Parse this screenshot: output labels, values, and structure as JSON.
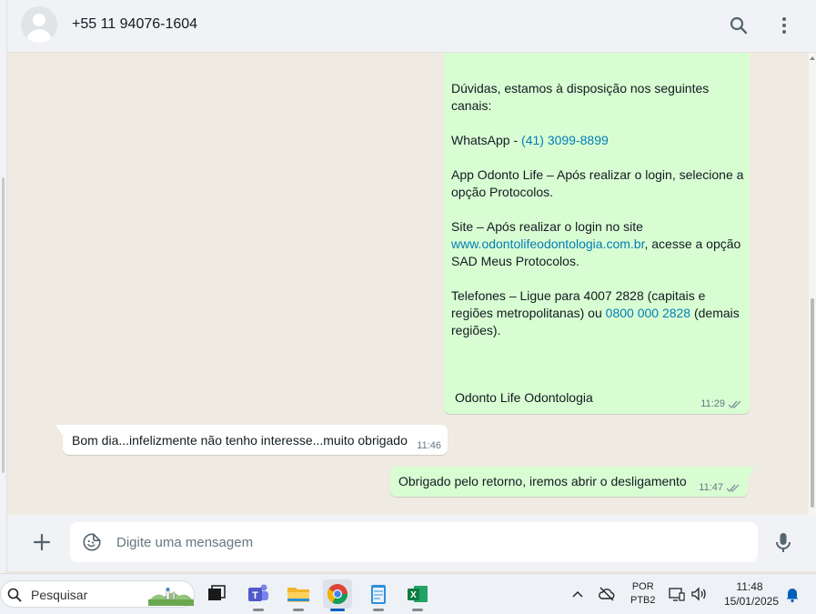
{
  "header": {
    "contact_name": "+55 11 94076-1604",
    "icons": [
      "avatar-icon",
      "search-icon",
      "menu-icon"
    ]
  },
  "messages": {
    "protocol": {
      "lines": [
        "Dúvidas, estamos à disposição nos seguintes canais:",
        "",
        "WhatsApp - ",
        "App Odonto Life – Após realizar o login, selecione a opção Protocolos.",
        "Site – Após realizar o login no site ",
        "Telefones – Ligue para 4007 2828 (capitais e regiões metropolitanas) ou "
      ],
      "p1": "Dúvidas, estamos à disposição nos seguintes canais:",
      "p2_prefix": "WhatsApp - ",
      "p2_link": "(41) 3099-8899",
      "p3": "App Odonto Life – Após realizar o login, selecione a opção Protocolos.",
      "p4_prefix": "Site – Após realizar o login no site ",
      "p4_link": "www.odontolifeodontologia.com.br",
      "p4_suffix": ", acesse a opção SAD Meus Protocolos.",
      "p5_prefix": "Telefones – Ligue para 4007 2828 (capitais e regiões metropolitanas) ou ",
      "p5_link": "0800 000 2828",
      "p5_suffix": " (demais regiões).",
      "signature": "Odonto Life Odontologia",
      "time": "11:29",
      "status": "double-check-icon"
    },
    "incoming": {
      "text": "Bom dia...infelizmente não tenho interesse...muito obrigado",
      "time": "11:46"
    },
    "outgoing": {
      "text": "Obrigado pelo retorno, iremos abrir o desligamento",
      "time": "11:47",
      "status": "double-check-icon"
    }
  },
  "composer": {
    "placeholder": "Digite uma mensagem",
    "icons": [
      "plus-icon",
      "sticker-icon",
      "microphone-icon"
    ]
  },
  "taskbar": {
    "search_placeholder": "Pesquisar",
    "apps": [
      "task-view-icon",
      "teams-icon",
      "file-explorer-icon",
      "chrome-icon",
      "notepad-icon",
      "excel-icon"
    ],
    "language_top": "POR",
    "language_bottom": "PTB2",
    "time": "11:48",
    "date": "15/01/2025",
    "colors": {
      "accent": "#005fb8",
      "bubble_out": "#d9fdd3",
      "link": "#027eb5"
    }
  }
}
